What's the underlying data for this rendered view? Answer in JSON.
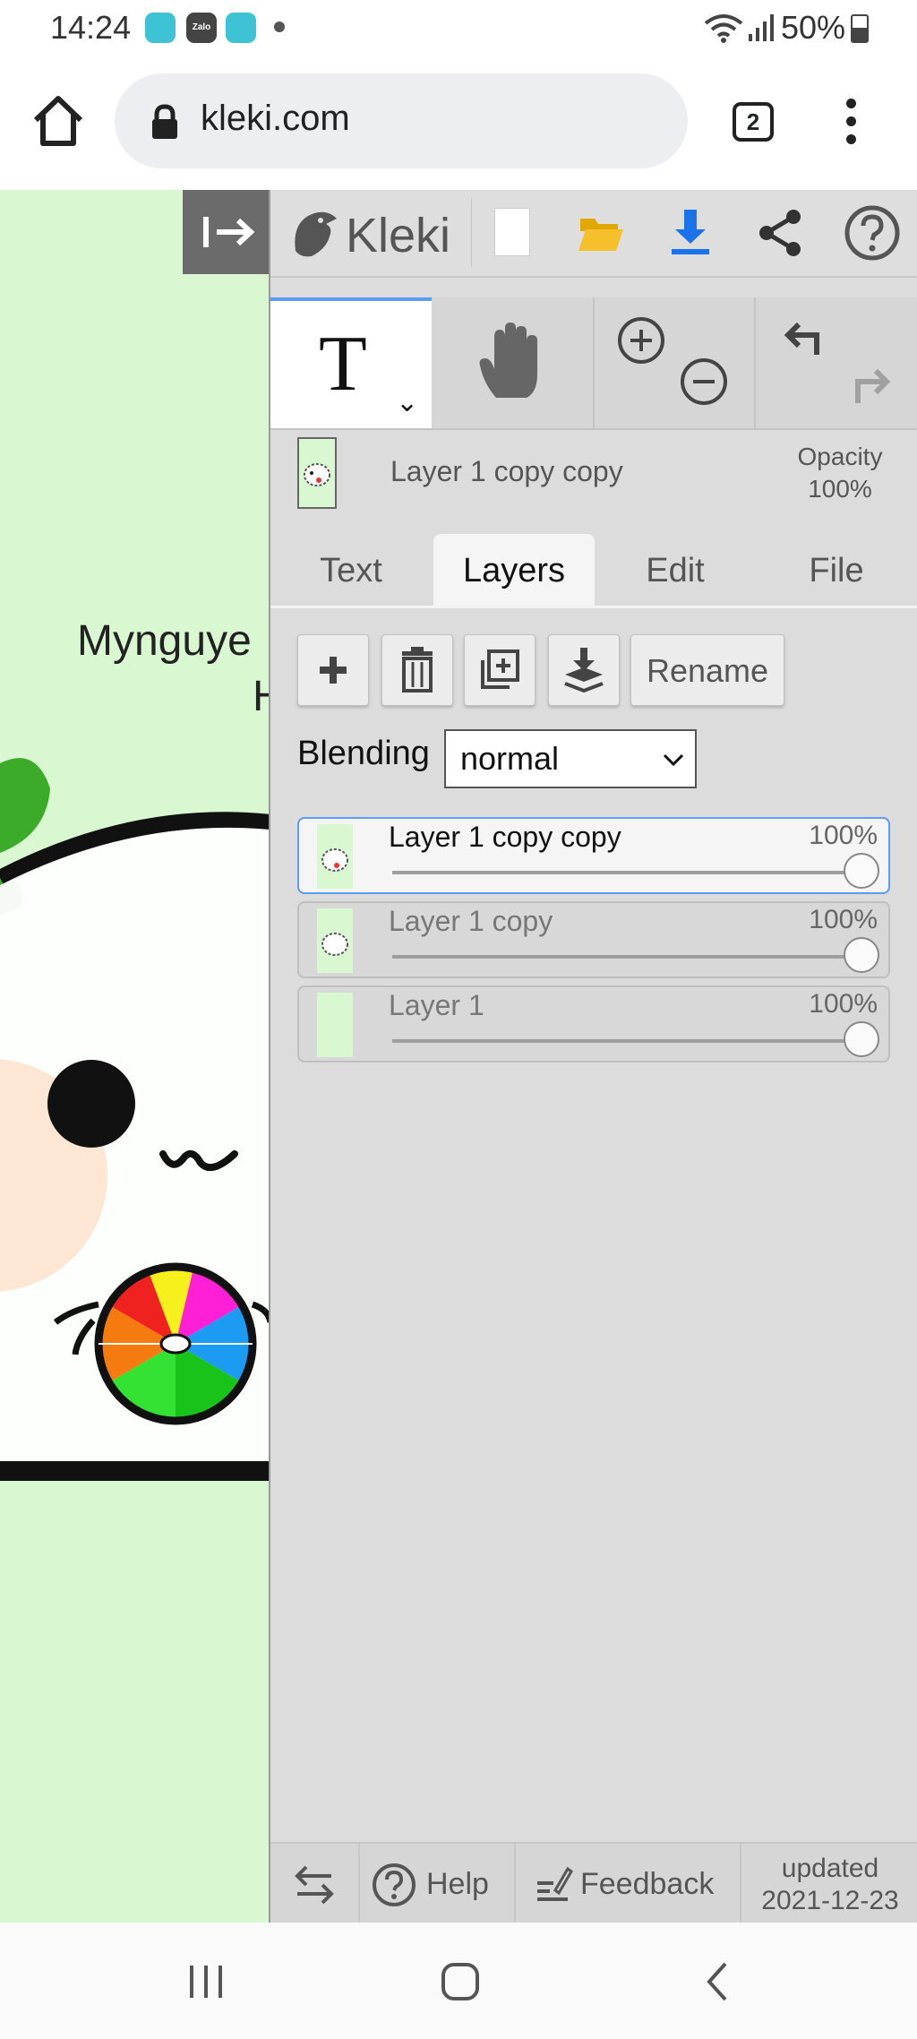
{
  "status_bar": {
    "time": "14:24",
    "app_icons": [
      "messenger-icon",
      "zalo-icon",
      "messenger-icon"
    ],
    "zalo_label": "Zalo",
    "battery": "50%"
  },
  "browser": {
    "url": "kleki.com",
    "tab_count": "2"
  },
  "canvas": {
    "text_line_1": "Mynguye",
    "text_line_2": "H",
    "background_color": "#d9f8d2"
  },
  "app": {
    "logo": "Kleki",
    "accent_color": "#5b9cf6",
    "download_color": "#1a73e8",
    "folder_color": "#f6c02c"
  },
  "tools": {
    "text_tool_glyph": "T",
    "chevron": "⌄"
  },
  "layer_info": {
    "active_layer_name": "Layer 1 copy copy",
    "opacity_label": "Opacity",
    "opacity_value": "100%"
  },
  "tabs": [
    {
      "label": "Text",
      "active": false
    },
    {
      "label": "Layers",
      "active": true
    },
    {
      "label": "Edit",
      "active": false
    },
    {
      "label": "File",
      "active": false
    }
  ],
  "layer_buttons": {
    "rename_label": "Rename"
  },
  "blending": {
    "label": "Blending",
    "value": "normal"
  },
  "layers": [
    {
      "name": "Layer 1 copy copy",
      "opacity": "100%",
      "opacity_fraction": 1.0,
      "selected": true
    },
    {
      "name": "Layer 1 copy",
      "opacity": "100%",
      "opacity_fraction": 1.0,
      "selected": false
    },
    {
      "name": "Layer 1",
      "opacity": "100%",
      "opacity_fraction": 1.0,
      "selected": false
    }
  ],
  "footer": {
    "help_label": "Help",
    "feedback_label": "Feedback",
    "updated_line_1": "updated",
    "updated_line_2": "2021-12-23"
  }
}
